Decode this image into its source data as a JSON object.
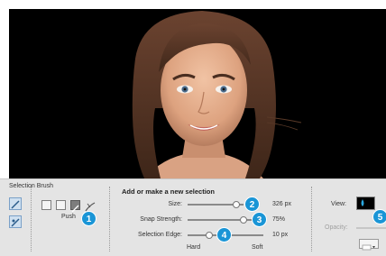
{
  "tool": {
    "title": "Selection Brush",
    "mode_label": "Push",
    "mode_icons": [
      "add-to-selection-icon",
      "subtract-from-selection-icon",
      "push-mode-icon",
      "refine-mode-icon"
    ]
  },
  "settings": {
    "heading": "Add or make a new selection",
    "size": {
      "label": "Size:",
      "value": "326 px",
      "level": 0.9
    },
    "snap_strength": {
      "label": "Snap Strength:",
      "value": "75%",
      "level": 0.75
    },
    "selection_edge": {
      "label": "Selection Edge:",
      "value": "10 px",
      "level": 0.1,
      "left_caption": "Hard",
      "right_caption": "Soft"
    }
  },
  "view": {
    "label": "View:",
    "opacity_label": "Opacity:"
  },
  "callouts": [
    "1",
    "2",
    "3",
    "4",
    "5"
  ],
  "colors": {
    "callout": "#1a95d6",
    "panel": "#e4e4e4",
    "canvas": "#000000"
  }
}
